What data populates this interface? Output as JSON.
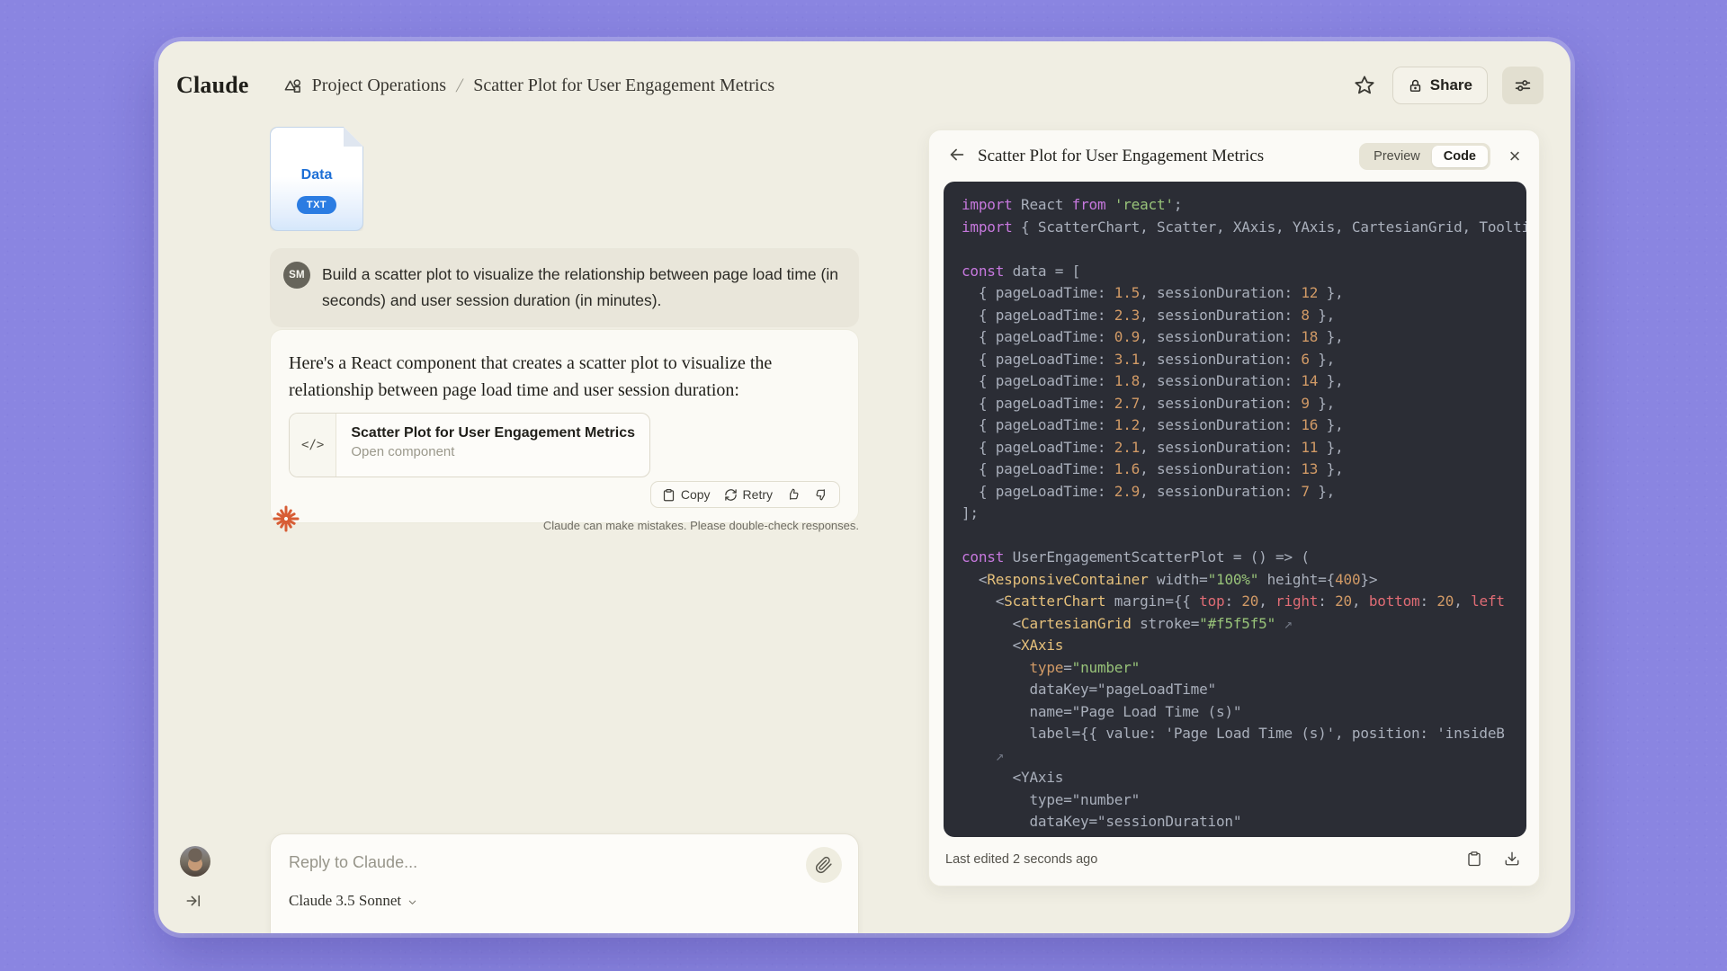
{
  "window": {
    "brand": "Claude",
    "breadcrumb": {
      "project": "Project Operations",
      "separator": "/",
      "page": "Scatter Plot for User Engagement Metrics"
    },
    "header_actions": {
      "share_label": "Share"
    }
  },
  "chat": {
    "file_card": {
      "name": "Data",
      "type_badge": "TXT"
    },
    "user_message": {
      "avatar_initials": "SM",
      "text": "Build a scatter plot to visualize the relationship between page load time (in seconds) and user session duration (in minutes)."
    },
    "assistant_message": {
      "intro": "Here's a React component that creates a scatter plot to visualize the relationship between page load time and user session duration:",
      "artifact_card": {
        "icon": "</>",
        "title": "Scatter Plot for User Engagement Metrics",
        "subtitle": "Open component"
      }
    },
    "message_actions": {
      "copy": "Copy",
      "retry": "Retry"
    },
    "disclaimer": "Claude can make mistakes. Please double-check responses.",
    "composer": {
      "placeholder": "Reply to Claude...",
      "model": "Claude 3.5 Sonnet"
    }
  },
  "artifact_panel": {
    "title": "Scatter Plot for User Engagement Metrics",
    "tabs": {
      "preview": "Preview",
      "code": "Code",
      "active": "Code"
    },
    "footer": {
      "status": "Last edited 2 seconds ago"
    },
    "code": {
      "scatter_data": [
        {
          "pageLoadTime": 1.5,
          "sessionDuration": 12
        },
        {
          "pageLoadTime": 2.3,
          "sessionDuration": 8
        },
        {
          "pageLoadTime": 0.9,
          "sessionDuration": 18
        },
        {
          "pageLoadTime": 3.1,
          "sessionDuration": 6
        },
        {
          "pageLoadTime": 1.8,
          "sessionDuration": 14
        },
        {
          "pageLoadTime": 2.7,
          "sessionDuration": 9
        },
        {
          "pageLoadTime": 1.2,
          "sessionDuration": 16
        },
        {
          "pageLoadTime": 2.1,
          "sessionDuration": 11
        },
        {
          "pageLoadTime": 1.6,
          "sessionDuration": 13
        },
        {
          "pageLoadTime": 2.9,
          "sessionDuration": 7
        }
      ],
      "lines": [
        [
          [
            "kw",
            "import"
          ],
          [
            "pl",
            " React "
          ],
          [
            "kw",
            "from"
          ],
          [
            "pl",
            " "
          ],
          [
            "str",
            "'react'"
          ],
          [
            "pl",
            ";"
          ]
        ],
        [
          [
            "kw",
            "import"
          ],
          [
            "pl",
            " { ScatterChart, Scatter, XAxis, YAxis, CartesianGrid, Toolti"
          ]
        ],
        [],
        [
          [
            "kw",
            "const"
          ],
          [
            "pl",
            " data = ["
          ]
        ],
        [
          [
            "pl",
            "  { pageLoadTime: "
          ],
          [
            "num",
            "1.5"
          ],
          [
            "pl",
            ", sessionDuration: "
          ],
          [
            "num",
            "12"
          ],
          [
            "pl",
            " },"
          ]
        ],
        [
          [
            "pl",
            "  { pageLoadTime: "
          ],
          [
            "num",
            "2.3"
          ],
          [
            "pl",
            ", sessionDuration: "
          ],
          [
            "num",
            "8"
          ],
          [
            "pl",
            " },"
          ]
        ],
        [
          [
            "pl",
            "  { pageLoadTime: "
          ],
          [
            "num",
            "0.9"
          ],
          [
            "pl",
            ", sessionDuration: "
          ],
          [
            "num",
            "18"
          ],
          [
            "pl",
            " },"
          ]
        ],
        [
          [
            "pl",
            "  { pageLoadTime: "
          ],
          [
            "num",
            "3.1"
          ],
          [
            "pl",
            ", sessionDuration: "
          ],
          [
            "num",
            "6"
          ],
          [
            "pl",
            " },"
          ]
        ],
        [
          [
            "pl",
            "  { pageLoadTime: "
          ],
          [
            "num",
            "1.8"
          ],
          [
            "pl",
            ", sessionDuration: "
          ],
          [
            "num",
            "14"
          ],
          [
            "pl",
            " },"
          ]
        ],
        [
          [
            "pl",
            "  { pageLoadTime: "
          ],
          [
            "num",
            "2.7"
          ],
          [
            "pl",
            ", sessionDuration: "
          ],
          [
            "num",
            "9"
          ],
          [
            "pl",
            " },"
          ]
        ],
        [
          [
            "pl",
            "  { pageLoadTime: "
          ],
          [
            "num",
            "1.2"
          ],
          [
            "pl",
            ", sessionDuration: "
          ],
          [
            "num",
            "16"
          ],
          [
            "pl",
            " },"
          ]
        ],
        [
          [
            "pl",
            "  { pageLoadTime: "
          ],
          [
            "num",
            "2.1"
          ],
          [
            "pl",
            ", sessionDuration: "
          ],
          [
            "num",
            "11"
          ],
          [
            "pl",
            " },"
          ]
        ],
        [
          [
            "pl",
            "  { pageLoadTime: "
          ],
          [
            "num",
            "1.6"
          ],
          [
            "pl",
            ", sessionDuration: "
          ],
          [
            "num",
            "13"
          ],
          [
            "pl",
            " },"
          ]
        ],
        [
          [
            "pl",
            "  { pageLoadTime: "
          ],
          [
            "num",
            "2.9"
          ],
          [
            "pl",
            ", sessionDuration: "
          ],
          [
            "num",
            "7"
          ],
          [
            "pl",
            " },"
          ]
        ],
        [
          [
            "pl",
            "];"
          ]
        ],
        [],
        [
          [
            "kw",
            "const"
          ],
          [
            "pl",
            " UserEngagementScatterPlot = () => ("
          ]
        ],
        [
          [
            "pl",
            "  <"
          ],
          [
            "tag",
            "ResponsiveContainer"
          ],
          [
            "pl",
            " width="
          ],
          [
            "str",
            "\"100%\""
          ],
          [
            "pl",
            " height={"
          ],
          [
            "num",
            "400"
          ],
          [
            "pl",
            "}>"
          ]
        ],
        [
          [
            "pl",
            "    <"
          ],
          [
            "tag",
            "ScatterChart"
          ],
          [
            "pl",
            " margin={{ "
          ],
          [
            "prop",
            "top"
          ],
          [
            "pl",
            ": "
          ],
          [
            "num",
            "20"
          ],
          [
            "pl",
            ", "
          ],
          [
            "prop",
            "right"
          ],
          [
            "pl",
            ": "
          ],
          [
            "num",
            "20"
          ],
          [
            "pl",
            ", "
          ],
          [
            "prop",
            "bottom"
          ],
          [
            "pl",
            ": "
          ],
          [
            "num",
            "20"
          ],
          [
            "pl",
            ", "
          ],
          [
            "prop",
            "left"
          ]
        ],
        [
          [
            "pl",
            "      <"
          ],
          [
            "tag",
            "CartesianGrid"
          ],
          [
            "pl",
            " stroke="
          ],
          [
            "str",
            "\"#f5f5f5\""
          ],
          [
            "pl",
            " "
          ],
          [
            "arw",
            "↗"
          ]
        ],
        [
          [
            "pl",
            "      <"
          ],
          [
            "tag",
            "XAxis"
          ]
        ],
        [
          [
            "pl",
            "        "
          ],
          [
            "num",
            "type"
          ],
          [
            "pl",
            "="
          ],
          [
            "str",
            "\"number\""
          ]
        ],
        [
          [
            "pl",
            "        dataKey=\"pageLoadTime\""
          ]
        ],
        [
          [
            "pl",
            "        name=\"Page Load Time (s)\""
          ]
        ],
        [
          [
            "pl",
            "        label={{ value: 'Page Load Time (s)', position: 'insideB"
          ]
        ],
        [
          [
            "pl",
            "    "
          ],
          [
            "arw",
            "↗"
          ]
        ],
        [
          [
            "pl",
            "      <YAxis"
          ]
        ],
        [
          [
            "pl",
            "        type=\"number\""
          ]
        ],
        [
          [
            "pl",
            "        dataKey=\"sessionDuration\""
          ]
        ]
      ]
    }
  },
  "colors": {
    "page_background": "#8a85e1",
    "window_background": "#f0eee3",
    "code_background": "#2b2d35",
    "file_accent_blue": "#2b7ce2",
    "claude_logo_orange": "#d75d35",
    "code_keyword": "#c678dd",
    "code_string": "#98c379",
    "code_number": "#d19a66",
    "code_tag": "#e5c07b",
    "code_property": "#e06c75"
  }
}
